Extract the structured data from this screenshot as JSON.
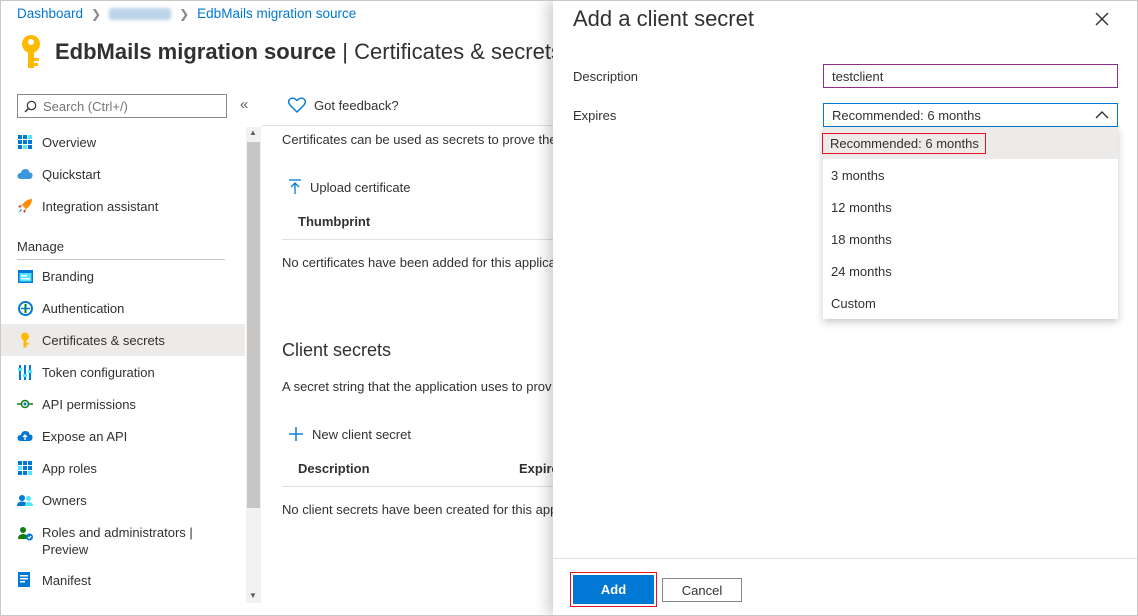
{
  "breadcrumb": {
    "items": [
      {
        "label": "Dashboard"
      },
      {
        "label": ""
      },
      {
        "label": "EdbMails migration source"
      }
    ]
  },
  "page": {
    "title": "EdbMails migration source",
    "title_sep": " | ",
    "subtitle": "Certificates & secrets"
  },
  "search": {
    "placeholder": "Search (Ctrl+/)"
  },
  "collapse_icon": "«",
  "nav": {
    "items": [
      {
        "label": "Overview",
        "icon": "grid-icon"
      },
      {
        "label": "Quickstart",
        "icon": "cloud-icon"
      },
      {
        "label": "Integration assistant",
        "icon": "rocket-icon"
      }
    ],
    "section": "Manage",
    "manage_items": [
      {
        "label": "Branding",
        "icon": "branding-icon"
      },
      {
        "label": "Authentication",
        "icon": "authentication-icon"
      },
      {
        "label": "Certificates & secrets",
        "icon": "key-icon",
        "active": true
      },
      {
        "label": "Token configuration",
        "icon": "token-icon"
      },
      {
        "label": "API permissions",
        "icon": "api-permissions-icon"
      },
      {
        "label": "Expose an API",
        "icon": "cloud-icon"
      },
      {
        "label": "App roles",
        "icon": "grid-icon"
      },
      {
        "label": "Owners",
        "icon": "owners-icon"
      },
      {
        "label": "Roles and administrators |",
        "label2": "Preview",
        "icon": "roles-icon"
      },
      {
        "label": "Manifest",
        "icon": "manifest-icon"
      }
    ]
  },
  "main": {
    "feedback": "Got feedback?",
    "cert_desc": "Certificates can be used as secrets to prove the",
    "upload_label": "Upload certificate",
    "thumbprint_header": "Thumbprint",
    "no_certs": "No certificates have been added for this applica",
    "client_secrets_title": "Client secrets",
    "secret_desc": "A secret string that the application uses to prov",
    "new_secret_label": "New client secret",
    "description_header": "Description",
    "expires_header": "Expire",
    "no_secrets": "No client secrets have been created for this app"
  },
  "panel": {
    "title": "Add a client secret",
    "description_label": "Description",
    "description_value": "testclient",
    "expires_label": "Expires",
    "expires_selected": "Recommended: 6 months",
    "options": [
      "Recommended: 6 months",
      "3 months",
      "12 months",
      "18 months",
      "24 months",
      "Custom"
    ],
    "add_label": "Add",
    "cancel_label": "Cancel"
  },
  "colors": {
    "accent": "#0078d4",
    "highlight": "#e81123",
    "key": "#ffb900"
  }
}
